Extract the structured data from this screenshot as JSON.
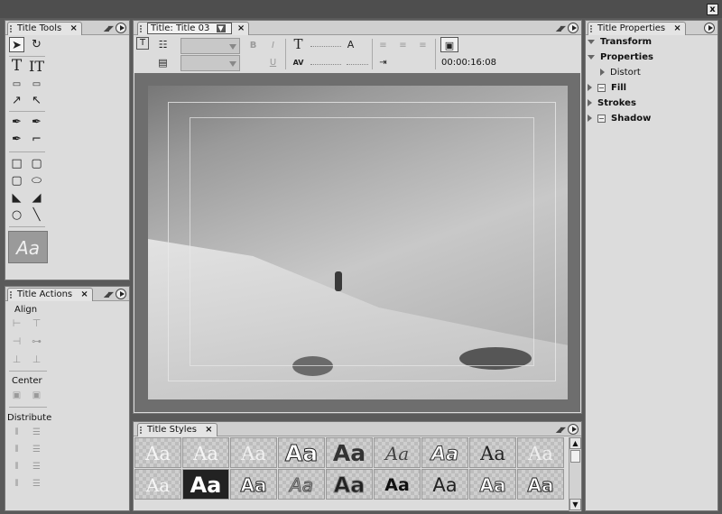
{
  "window": {
    "close_label": "x"
  },
  "panels": {
    "title_tools": {
      "tab": "Title Tools",
      "close": "×"
    },
    "title_actions": {
      "tab": "Title Actions",
      "close": "×",
      "align_label": "Align",
      "center_label": "Center",
      "distribute_label": "Distribute"
    },
    "title_editor": {
      "tab": "Title: Title 03",
      "close": "×",
      "timecode": "00:00:16:08"
    },
    "title_properties": {
      "tab": "Title Properties",
      "close": "×",
      "items": [
        {
          "label": "Transform",
          "bold": true
        },
        {
          "label": "Properties",
          "bold": true
        },
        {
          "label": "Distort",
          "bold": false
        },
        {
          "label": "Fill",
          "bold": true
        },
        {
          "label": "Strokes",
          "bold": true
        },
        {
          "label": "Shadow",
          "bold": true
        }
      ]
    },
    "title_styles": {
      "tab": "Title Styles",
      "close": "×",
      "sample": "Aa"
    }
  },
  "tools": {
    "preview_sample": "Aa"
  },
  "colors": {
    "panel_bg": "#dcdcdc",
    "frame_bg": "#5a5a5a",
    "monitor_bg": "#6e6e6e"
  }
}
